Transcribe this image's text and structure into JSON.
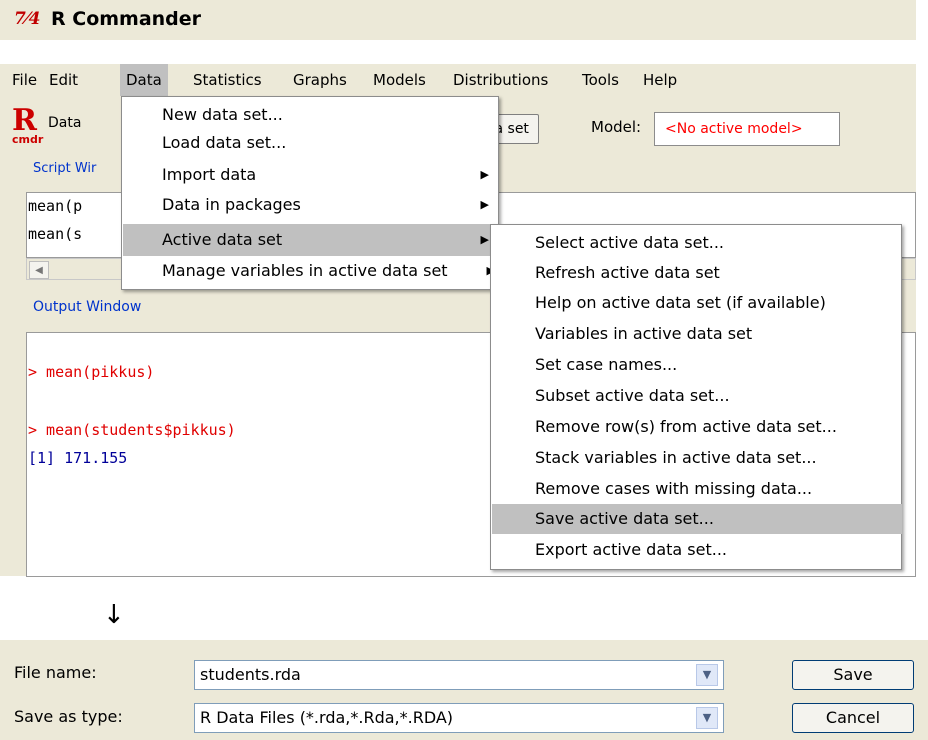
{
  "window": {
    "logo": "7⁄4",
    "title": "R Commander"
  },
  "menubar": {
    "items": [
      "File",
      "Edit",
      "Data",
      "Statistics",
      "Graphs",
      "Models",
      "Distributions",
      "Tools",
      "Help"
    ]
  },
  "toolbar": {
    "logo_letter": "R",
    "logo_sub": "cmdr",
    "data_label": "Data",
    "dataset_button_visible": "ta set",
    "model_label": "Model:",
    "model_value": "<No active model>"
  },
  "script_window": {
    "label": "Script Wir",
    "lines": [
      "mean(p",
      "mean(s"
    ]
  },
  "output_window": {
    "label": "Output Window",
    "lines": [
      "> mean(pikkus)",
      "> mean(students$pikkus)",
      "[1] 171.155"
    ]
  },
  "data_menu": {
    "items": [
      "New data set...",
      "Load data set...",
      "Import data",
      "Data in packages",
      "Active data set",
      "Manage variables in active data set"
    ],
    "highlighted": "Active data set"
  },
  "active_data_set_submenu": {
    "items": [
      "Select active data set...",
      "Refresh active data set",
      "Help on active data set (if available)",
      "Variables in active data set",
      "Set case names...",
      "Subset active data set...",
      "Remove row(s) from active data set...",
      "Stack variables in active data set...",
      "Remove cases with missing data...",
      "Save active data set...",
      "Export active data set..."
    ],
    "highlighted": "Save active data set..."
  },
  "transition_arrow": "↓",
  "save_dialog": {
    "file_name_label": "File name:",
    "file_name_value": "students.rda",
    "save_as_type_label": "Save as type:",
    "save_as_type_value": "R Data Files (*.rda,*.Rda,*.RDA)",
    "save_button": "Save",
    "cancel_button": "Cancel"
  },
  "colors": {
    "menu_highlight": "#c0c0c0",
    "command_red": "#e00000",
    "output_blue": "#000099",
    "label_blue": "#0033cc"
  }
}
